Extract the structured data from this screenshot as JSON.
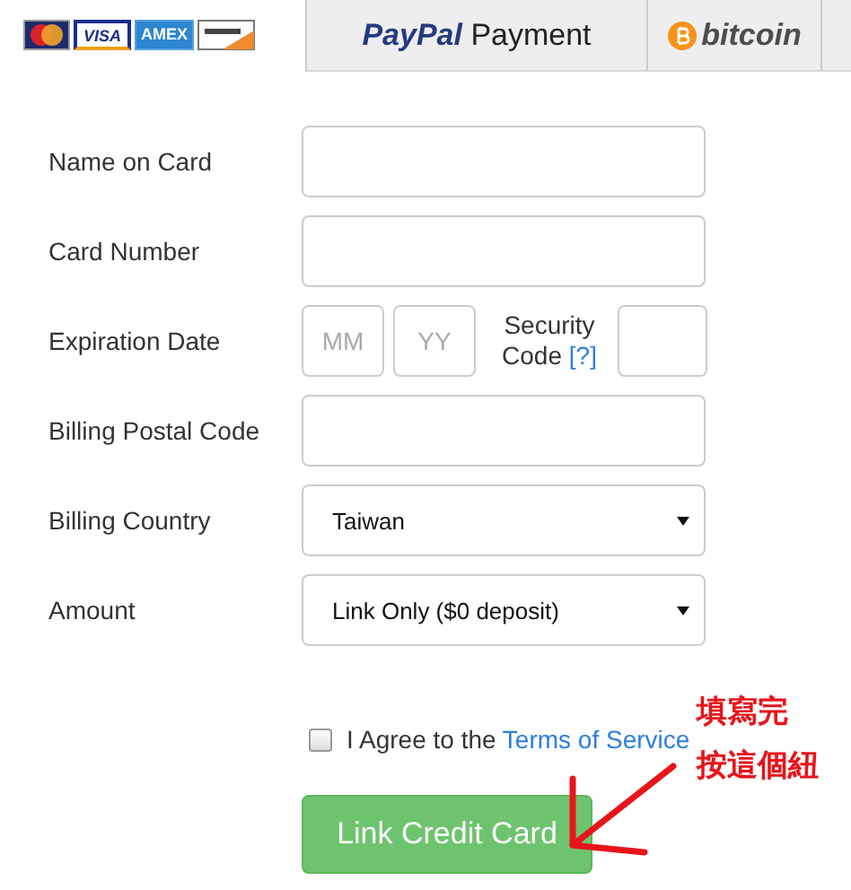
{
  "tabs": [
    {
      "kind": "cards",
      "selected": true,
      "cards": [
        {
          "kind": "mastercard"
        },
        {
          "kind": "visa",
          "label": "VISA"
        },
        {
          "kind": "amex",
          "label": "AMEX"
        },
        {
          "kind": "discover"
        }
      ]
    },
    {
      "kind": "paypal",
      "selected": false,
      "brand": "PayPal",
      "label": "Payment"
    },
    {
      "kind": "bitcoin",
      "selected": false,
      "label": "bitcoin"
    },
    {
      "kind": "blank",
      "selected": false
    }
  ],
  "form": {
    "fields": [
      {
        "kind": "text",
        "label": "Name on Card"
      },
      {
        "kind": "text",
        "label": "Card Number"
      },
      {
        "kind": "expiry",
        "label": "Expiration Date",
        "month_placeholder": "MM",
        "year_placeholder": "YY",
        "security_label": "Security Code",
        "help_link": "[?]"
      },
      {
        "kind": "text",
        "label": "Billing Postal Code"
      },
      {
        "kind": "select",
        "label": "Billing Country",
        "value": "Taiwan"
      },
      {
        "kind": "select",
        "label": "Amount",
        "value": "Link Only ($0 deposit)"
      }
    ],
    "agree": {
      "checked": false,
      "text": "I Agree to the",
      "link": "Terms of Service"
    },
    "submit": "Link Credit Card"
  },
  "annotation": {
    "lines": [
      "填寫完",
      "按這個紐"
    ]
  }
}
